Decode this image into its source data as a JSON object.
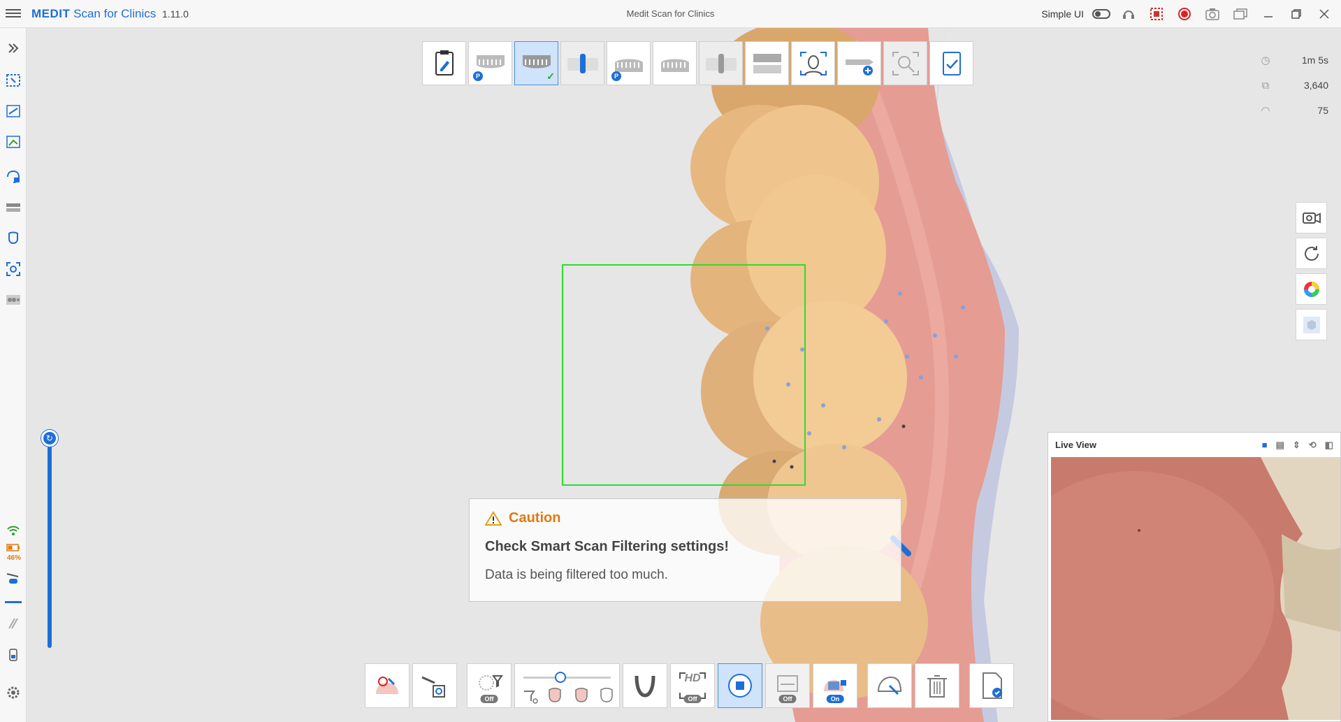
{
  "titlebar": {
    "brand": "MEDIT",
    "product": "Scan for Clinics",
    "version": "1.11.0",
    "window_title": "Medit Scan for Clinics",
    "simple_ui_label": "Simple UI"
  },
  "sidebar": {
    "battery_percent": "46%"
  },
  "stats": {
    "time": "1m 5s",
    "frames": "3,640",
    "speed": "75"
  },
  "caution": {
    "heading": "Caution",
    "title": "Check Smart Scan Filtering settings!",
    "message": "Data is being filtered too much."
  },
  "liveview": {
    "title": "Live View"
  },
  "bottombar": {
    "filter_off": "Off",
    "hd_label": "HD",
    "hd_off": "Off",
    "ai_off": "Off",
    "lock_on": "On"
  },
  "colors": {
    "accent": "#1e6ed6",
    "caution": "#e07a10",
    "scan_frame": "#2fdc2f",
    "record": "#dd2222"
  }
}
